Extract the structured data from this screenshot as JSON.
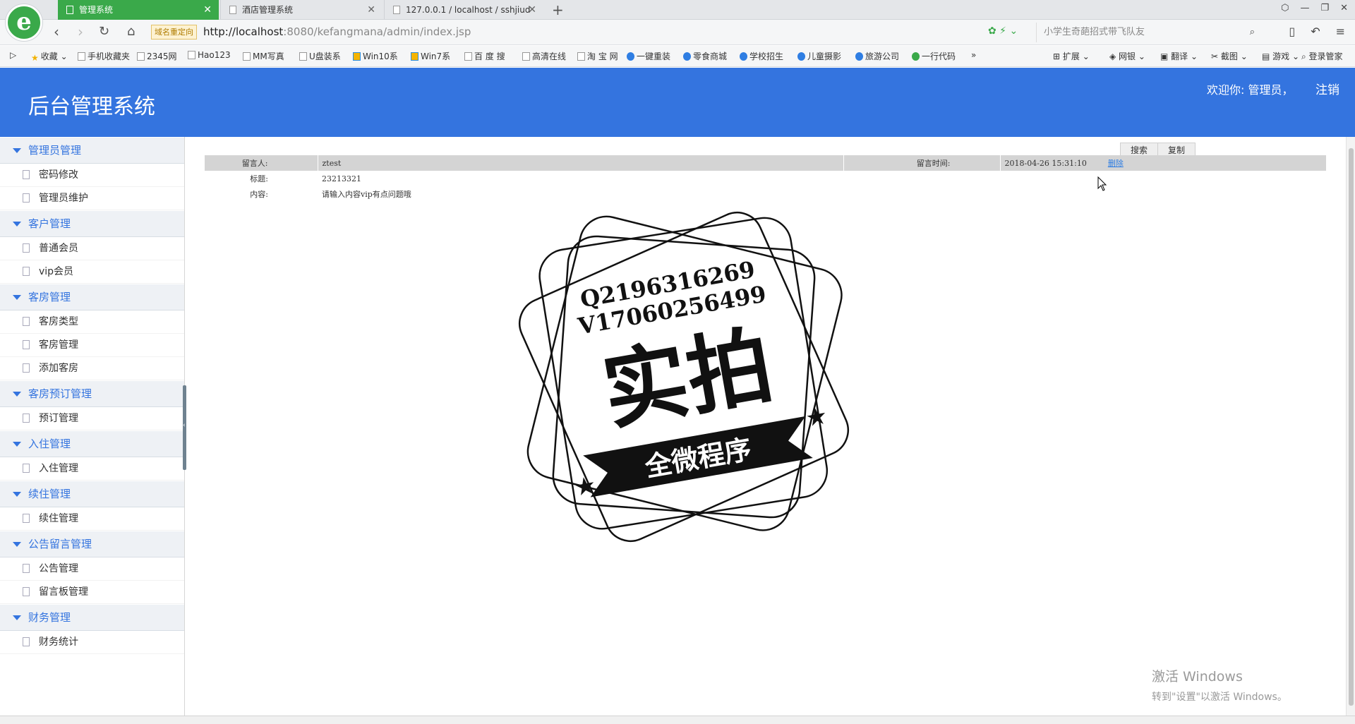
{
  "browser": {
    "tabs": [
      {
        "label": "管理系统",
        "active": true
      },
      {
        "label": "酒店管理系统",
        "active": false
      },
      {
        "label": "127.0.0.1 / localhost / sshjiud",
        "active": false
      }
    ],
    "new_tab": "+",
    "redirect_badge": "域名重定向",
    "url_host": "http://localhost",
    "url_path": ":8080/kefangmana/admin/index.jsp",
    "search_placeholder": "小学生奇葩招式带飞队友",
    "bookmarks": [
      {
        "label": "收藏",
        "icon": "star"
      },
      {
        "label": "手机收藏夹",
        "icon": "phone"
      },
      {
        "label": "2345网",
        "icon": "page"
      },
      {
        "label": "Hao123",
        "icon": "page"
      },
      {
        "label": "MM写真",
        "icon": "page"
      },
      {
        "label": "U盘装系",
        "icon": "page"
      },
      {
        "label": "Win10系",
        "icon": "windows"
      },
      {
        "label": "Win7系",
        "icon": "windows"
      },
      {
        "label": "百 度 搜",
        "icon": "page"
      },
      {
        "label": "高清在线",
        "icon": "page"
      },
      {
        "label": "淘 宝 网",
        "icon": "page"
      },
      {
        "label": "一键重装",
        "icon": "blue"
      },
      {
        "label": "零食商城",
        "icon": "blue"
      },
      {
        "label": "学校招生",
        "icon": "blue"
      },
      {
        "label": "儿童摄影",
        "icon": "blue"
      },
      {
        "label": "旅游公司",
        "icon": "blue"
      },
      {
        "label": "一行代码",
        "icon": "green"
      },
      {
        "label": "»",
        "icon": "none"
      }
    ],
    "bookmark_tools": [
      {
        "label": "扩展"
      },
      {
        "label": "网银"
      },
      {
        "label": "翻译"
      },
      {
        "label": "截图"
      },
      {
        "label": "游戏"
      },
      {
        "label": "登录管家"
      }
    ]
  },
  "header": {
    "title": "后台管理系统",
    "welcome": "欢迎你: 管理员，",
    "logout": "注销"
  },
  "sidebar": {
    "groups": [
      {
        "label": "管理员管理",
        "items": [
          "密码修改",
          "管理员维护"
        ]
      },
      {
        "label": "客户管理",
        "items": [
          "普通会员",
          "vip会员"
        ]
      },
      {
        "label": "客房管理",
        "items": [
          "客房类型",
          "客房管理",
          "添加客房"
        ]
      },
      {
        "label": "客房预订管理",
        "items": [
          "预订管理"
        ]
      },
      {
        "label": "入住管理",
        "items": [
          "入住管理"
        ]
      },
      {
        "label": "续住管理",
        "items": [
          "续住管理"
        ]
      },
      {
        "label": "公告留言管理",
        "items": [
          "公告管理",
          "留言板管理"
        ]
      },
      {
        "label": "财务管理",
        "items": [
          "财务统计"
        ]
      }
    ]
  },
  "content": {
    "toolbar": {
      "search_label": "搜索",
      "copy_label": "复制"
    },
    "message": {
      "author_label": "留言人:",
      "author_value": "ztest",
      "time_label": "留言时间:",
      "time_value": "2018-04-26 15:31:10",
      "sort_link": "删除",
      "title_label": "标题:",
      "title_value": "23213321",
      "content_label": "内容:",
      "content_value": "请输入内容vip有点问题哦"
    },
    "stamp": {
      "line1": "Q2196316269",
      "line2": "V17060256499",
      "main": "实拍",
      "banner": "全微程序"
    },
    "watermark": {
      "line1": "激活 Windows",
      "line2": "转到\"设置\"以激活 Windows。"
    }
  }
}
